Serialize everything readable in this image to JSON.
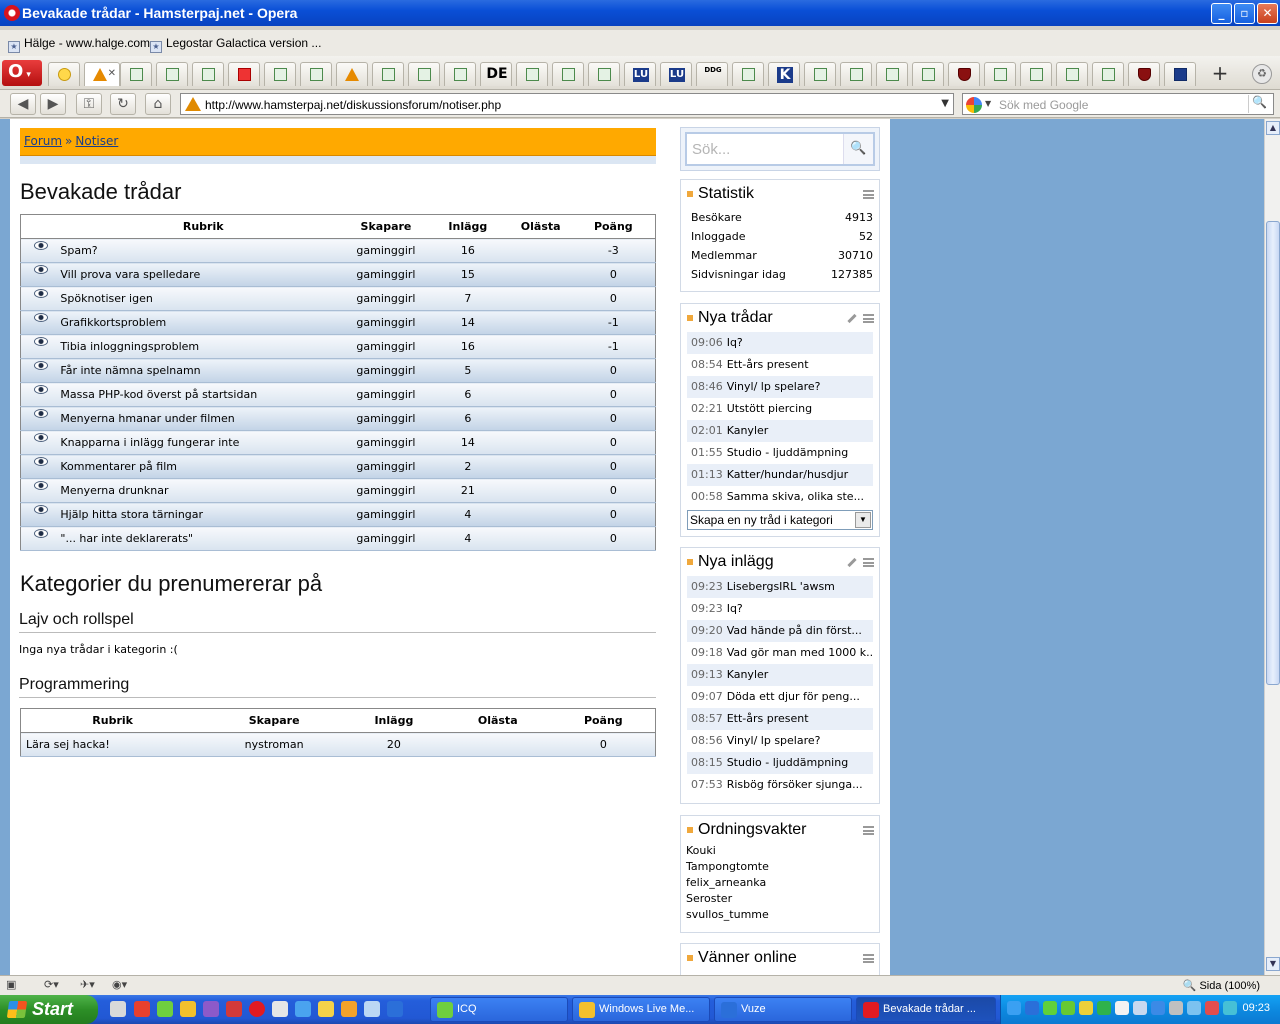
{
  "window": {
    "title": "Bevakade trådar - Hamsterpaj.net - Opera"
  },
  "bookmarks": [
    {
      "label": "Hälge - www.halge.com"
    },
    {
      "label": "Legostar Galactica version ..."
    }
  ],
  "tabs": [
    {
      "icon": "speed-dial-icon",
      "text": ""
    },
    {
      "icon": "hamsterpaj-icon",
      "text": "",
      "active": true
    },
    {
      "icon": "java-icon",
      "text": ""
    },
    {
      "icon": "page-icon",
      "text": ""
    },
    {
      "icon": "page-icon",
      "text": ""
    },
    {
      "icon": "lastfm-icon",
      "text": ""
    },
    {
      "icon": "page-icon",
      "text": ""
    },
    {
      "icon": "page-icon",
      "text": ""
    },
    {
      "icon": "warning-icon",
      "text": ""
    },
    {
      "icon": "person-icon",
      "text": ""
    },
    {
      "icon": "page-icon",
      "text": ""
    },
    {
      "icon": "google-icon",
      "text": ""
    },
    {
      "icon": "text-icon",
      "text": "DE"
    },
    {
      "icon": "page-icon",
      "text": ""
    },
    {
      "icon": "page-icon",
      "text": ""
    },
    {
      "icon": "swirl-icon",
      "text": ""
    },
    {
      "icon": "lu-icon",
      "text": "LU"
    },
    {
      "icon": "lu-icon",
      "text": "LU"
    },
    {
      "icon": "lth-icon",
      "text": "DDG"
    },
    {
      "icon": "rainbow-icon",
      "text": ""
    },
    {
      "icon": "k-icon",
      "text": "K"
    },
    {
      "icon": "page-icon",
      "text": ""
    },
    {
      "icon": "page-icon",
      "text": ""
    },
    {
      "icon": "cake-icon",
      "text": ""
    },
    {
      "icon": "page-icon",
      "text": ""
    },
    {
      "icon": "shield-icon",
      "text": ""
    },
    {
      "icon": "page-icon",
      "text": ""
    },
    {
      "icon": "page-icon",
      "text": ""
    },
    {
      "icon": "page-icon",
      "text": ""
    },
    {
      "icon": "house-icon",
      "text": ""
    },
    {
      "icon": "shield-icon",
      "text": ""
    },
    {
      "icon": "vader-icon",
      "text": ""
    }
  ],
  "address": {
    "url": "http://www.hamsterpaj.net/diskussionsforum/notiser.php",
    "search_placeholder": "Sök med Google"
  },
  "breadcrumb": {
    "items": [
      "Forum",
      "Notiser"
    ],
    "separator": "»"
  },
  "watched": {
    "title": "Bevakade trådar",
    "headers": [
      "Rubrik",
      "Skapare",
      "Inlägg",
      "Olästa",
      "Poäng"
    ],
    "rows": [
      {
        "rubrik": "Spam?",
        "skapare": "gaminggirl",
        "inlagg": "16",
        "olasta": "",
        "poang": "-3"
      },
      {
        "rubrik": "Vill prova vara spelledare",
        "skapare": "gaminggirl",
        "inlagg": "15",
        "olasta": "",
        "poang": "0"
      },
      {
        "rubrik": "Spöknotiser igen",
        "skapare": "gaminggirl",
        "inlagg": "7",
        "olasta": "",
        "poang": "0"
      },
      {
        "rubrik": "Grafikkortsproblem",
        "skapare": "gaminggirl",
        "inlagg": "14",
        "olasta": "",
        "poang": "-1"
      },
      {
        "rubrik": "Tibia inloggningsproblem",
        "skapare": "gaminggirl",
        "inlagg": "16",
        "olasta": "",
        "poang": "-1"
      },
      {
        "rubrik": "Får inte nämna spelnamn",
        "skapare": "gaminggirl",
        "inlagg": "5",
        "olasta": "",
        "poang": "0"
      },
      {
        "rubrik": "Massa PHP-kod överst på startsidan",
        "skapare": "gaminggirl",
        "inlagg": "6",
        "olasta": "",
        "poang": "0"
      },
      {
        "rubrik": "Menyerna hmanar under filmen",
        "skapare": "gaminggirl",
        "inlagg": "6",
        "olasta": "",
        "poang": "0"
      },
      {
        "rubrik": "Knapparna i inlägg fungerar inte",
        "skapare": "gaminggirl",
        "inlagg": "14",
        "olasta": "",
        "poang": "0"
      },
      {
        "rubrik": "Kommentarer på film",
        "skapare": "gaminggirl",
        "inlagg": "2",
        "olasta": "",
        "poang": "0"
      },
      {
        "rubrik": "Menyerna drunknar",
        "skapare": "gaminggirl",
        "inlagg": "21",
        "olasta": "",
        "poang": "0"
      },
      {
        "rubrik": "Hjälp hitta stora tärningar",
        "skapare": "gaminggirl",
        "inlagg": "4",
        "olasta": "",
        "poang": "0"
      },
      {
        "rubrik": "\"... har inte deklarerats\"",
        "skapare": "gaminggirl",
        "inlagg": "4",
        "olasta": "",
        "poang": "0"
      }
    ]
  },
  "subscriptions": {
    "title": "Kategorier du prenumererar på",
    "categories": [
      {
        "name": "Lajv och rollspel",
        "empty_text": "Inga nya trådar i kategorin :("
      },
      {
        "name": "Programmering"
      }
    ],
    "prog_headers": [
      "Rubrik",
      "Skapare",
      "Inlägg",
      "Olästa",
      "Poäng"
    ],
    "prog_rows": [
      {
        "rubrik": "Lära sej hacka!",
        "skapare": "nystroman",
        "inlagg": "20",
        "olasta": "",
        "poang": "0"
      }
    ]
  },
  "sidebar": {
    "search_placeholder": "Sök...",
    "statistik": {
      "title": "Statistik",
      "rows": [
        {
          "k": "Besökare",
          "v": "4913"
        },
        {
          "k": "Inloggade",
          "v": "52"
        },
        {
          "k": "Medlemmar",
          "v": "30710"
        },
        {
          "k": "Sidvisningar idag",
          "v": "127385"
        }
      ]
    },
    "nya_tradar": {
      "title": "Nya trådar",
      "items": [
        {
          "time": "09:06",
          "text": "Iq?"
        },
        {
          "time": "08:54",
          "text": "Ett-års present"
        },
        {
          "time": "08:46",
          "text": "Vinyl/ lp spelare?"
        },
        {
          "time": "02:21",
          "text": "Utstött piercing"
        },
        {
          "time": "02:01",
          "text": "Kanyler"
        },
        {
          "time": "01:55",
          "text": "Studio - ljuddämpning"
        },
        {
          "time": "01:13",
          "text": "Katter/hundar/husdjur"
        },
        {
          "time": "00:58",
          "text": "Samma skiva, olika ste..."
        }
      ],
      "select_value": "Skapa en ny tråd i kategori"
    },
    "nya_inlagg": {
      "title": "Nya inlägg",
      "items": [
        {
          "time": "09:23",
          "text": "LisebergsIRL 'awsm"
        },
        {
          "time": "09:23",
          "text": "Iq?"
        },
        {
          "time": "09:20",
          "text": "Vad hände på din först..."
        },
        {
          "time": "09:18",
          "text": "Vad gör man med 1000 k..."
        },
        {
          "time": "09:13",
          "text": "Kanyler"
        },
        {
          "time": "09:07",
          "text": "Döda ett djur för peng..."
        },
        {
          "time": "08:57",
          "text": "Ett-års present"
        },
        {
          "time": "08:56",
          "text": "Vinyl/ lp spelare?"
        },
        {
          "time": "08:15",
          "text": "Studio - ljuddämpning"
        },
        {
          "time": "07:53",
          "text": "Risbög försöker sjunga..."
        }
      ]
    },
    "ordningsvakter": {
      "title": "Ordningsvakter",
      "names": [
        "Kouki",
        "Tampongtomte",
        "felix_arneanka",
        "Seroster",
        "svullos_tumme"
      ]
    },
    "vanner": {
      "title": "Vänner online"
    }
  },
  "statusbar": {
    "zoom": "Sida (100%)"
  },
  "taskbar": {
    "start": "Start",
    "items": [
      {
        "label": "ICQ",
        "active": false
      },
      {
        "label": "Windows Live Me...",
        "active": false
      },
      {
        "label": "Vuze",
        "active": false
      },
      {
        "label": "Bevakade trådar ...",
        "active": true
      }
    ],
    "clock": "09:23"
  }
}
